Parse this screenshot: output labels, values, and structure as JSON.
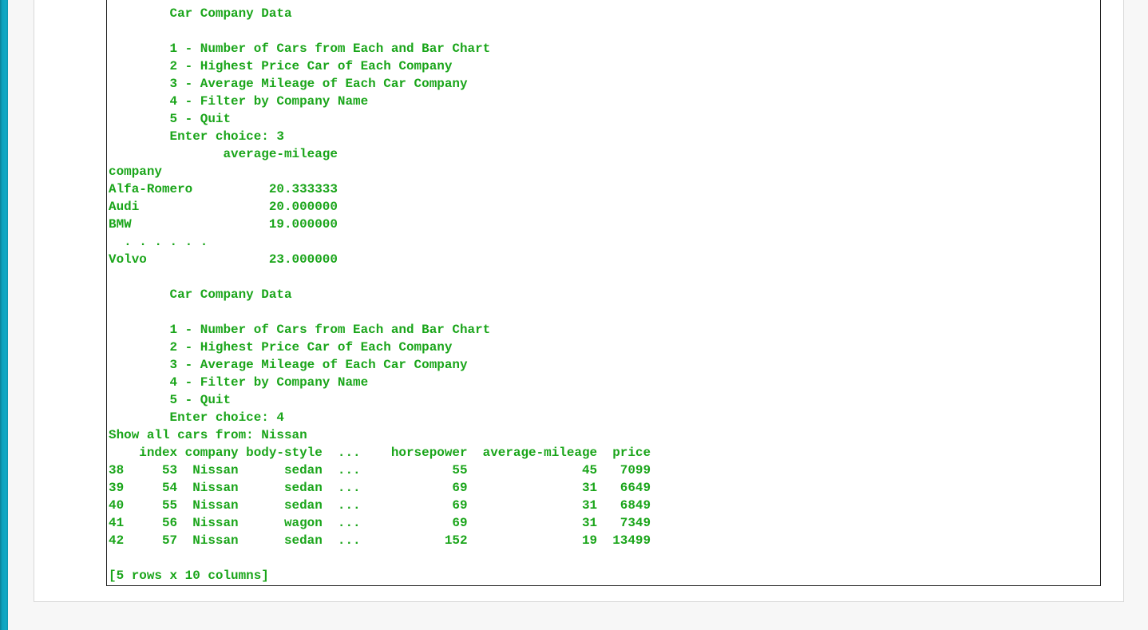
{
  "colors": {
    "console_text": "#1aa51a",
    "accent_bar": "#12a8c4",
    "page_background": "#f7f7f7",
    "panel_background": "#ffffff"
  },
  "console": {
    "lines": [
      "        Car Company Data",
      "",
      "        1 - Number of Cars from Each and Bar Chart",
      "        2 - Highest Price Car of Each Company",
      "        3 - Average Mileage of Each Car Company",
      "        4 - Filter by Company Name",
      "        5 - Quit",
      "        Enter choice: 3",
      "               average-mileage",
      "company",
      "Alfa-Romero          20.333333",
      "Audi                 20.000000",
      "BMW                  19.000000",
      "  . . . . . .",
      "Volvo                23.000000",
      "",
      "        Car Company Data",
      "",
      "        1 - Number of Cars from Each and Bar Chart",
      "        2 - Highest Price Car of Each Company",
      "        3 - Average Mileage of Each Car Company",
      "        4 - Filter by Company Name",
      "        5 - Quit",
      "        Enter choice: 4",
      "Show all cars from: Nissan",
      "    index company body-style  ...    horsepower  average-mileage  price",
      "38     53  Nissan      sedan  ...            55               45   7099",
      "39     54  Nissan      sedan  ...            69               31   6649",
      "40     55  Nissan      sedan  ...            69               31   6849",
      "41     56  Nissan      wagon  ...            69               31   7349",
      "42     57  Nissan      sedan  ...           152               19  13499",
      "",
      "[5 rows x 10 columns]"
    ]
  }
}
